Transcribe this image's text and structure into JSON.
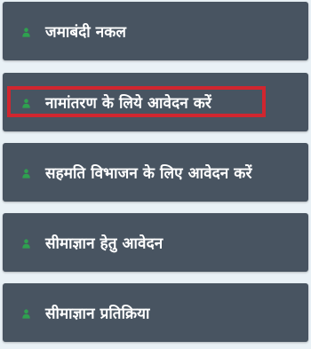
{
  "menu": {
    "items": [
      {
        "label": "जमाबंदी नकल",
        "icon": "user-icon"
      },
      {
        "label": "नामांतरण के लिये आवेदन करें",
        "icon": "user-icon",
        "highlighted": true
      },
      {
        "label": "सहमति विभाजन के लिए आवेदन करें",
        "icon": "user-icon"
      },
      {
        "label": "सीमाज्ञान हेतु आवेदन",
        "icon": "user-icon"
      },
      {
        "label": "सीमाज्ञान प्रतिक्रिया",
        "icon": "user-icon"
      }
    ],
    "colors": {
      "page_background": "#e9f1f6",
      "card_background": "#485461",
      "icon": "#2fa14f",
      "highlight_border": "#d1262f"
    }
  }
}
